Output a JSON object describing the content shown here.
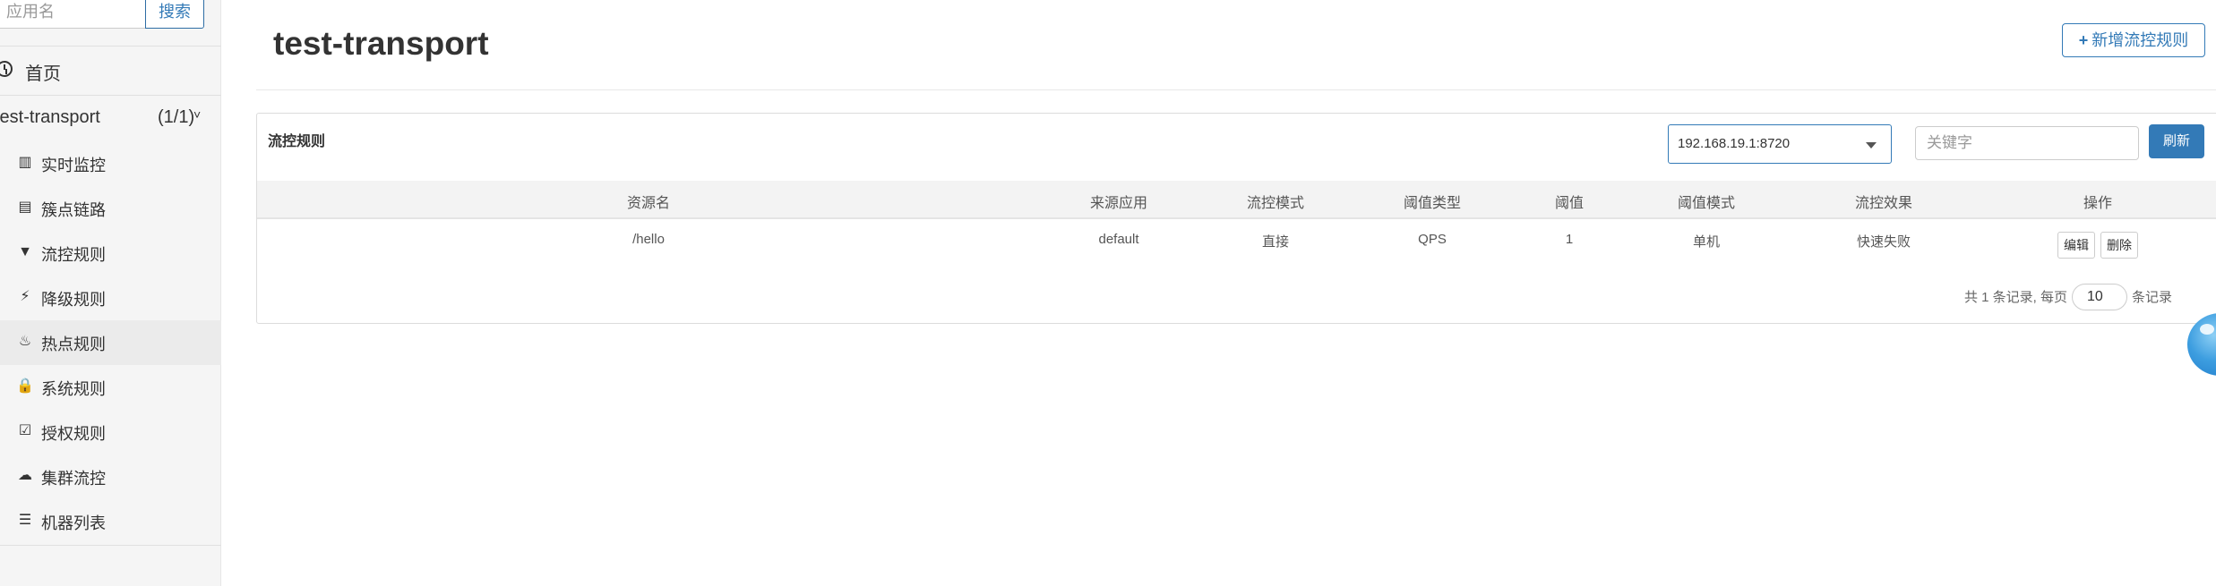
{
  "sidebar": {
    "search_placeholder": "应用名",
    "search_button": "搜索",
    "home_label": "首页",
    "app_name": "test-transport",
    "app_count": "(1/1)",
    "app_chevron": "˅",
    "menu": [
      {
        "label": "实时监控",
        "icon": "bar-chart-icon",
        "glyph": "▥"
      },
      {
        "label": "簇点链路",
        "icon": "list-book-icon",
        "glyph": "▤"
      },
      {
        "label": "流控规则",
        "icon": "filter-icon",
        "glyph": "▼"
      },
      {
        "label": "降级规则",
        "icon": "flash-icon",
        "glyph": "⚡"
      },
      {
        "label": "热点规则",
        "icon": "fire-icon",
        "glyph": "♨"
      },
      {
        "label": "系统规则",
        "icon": "lock-icon",
        "glyph": "🔒"
      },
      {
        "label": "授权规则",
        "icon": "check-square-icon",
        "glyph": "☑"
      },
      {
        "label": "集群流控",
        "icon": "cloud-icon",
        "glyph": "☁"
      },
      {
        "label": "机器列表",
        "icon": "list-icon",
        "glyph": "☰"
      }
    ]
  },
  "header": {
    "title": "test-transport",
    "add_button_plus": "+",
    "add_button": "新增流控规则"
  },
  "panel": {
    "title": "流控规则",
    "machine_selected": "192.168.19.1:8720",
    "keyword_placeholder": "关键字",
    "refresh_button": "刷新"
  },
  "table": {
    "columns": [
      "资源名",
      "来源应用",
      "流控模式",
      "阈值类型",
      "阈值",
      "阈值模式",
      "流控效果",
      "操作"
    ],
    "rows": [
      {
        "resource": "/hello",
        "source": "default",
        "mode": "直接",
        "threshold_type": "QPS",
        "threshold": "1",
        "threshold_mode": "单机",
        "effect": "快速失败"
      }
    ],
    "actions": {
      "edit": "编辑",
      "delete": "删除"
    }
  },
  "pagination": {
    "summary": "共 1 条记录, 每页",
    "page_size": "10",
    "suffix": "条记录"
  },
  "colors": {
    "primary": "#337ab7",
    "sidebar_bg": "#f5f5f5"
  }
}
